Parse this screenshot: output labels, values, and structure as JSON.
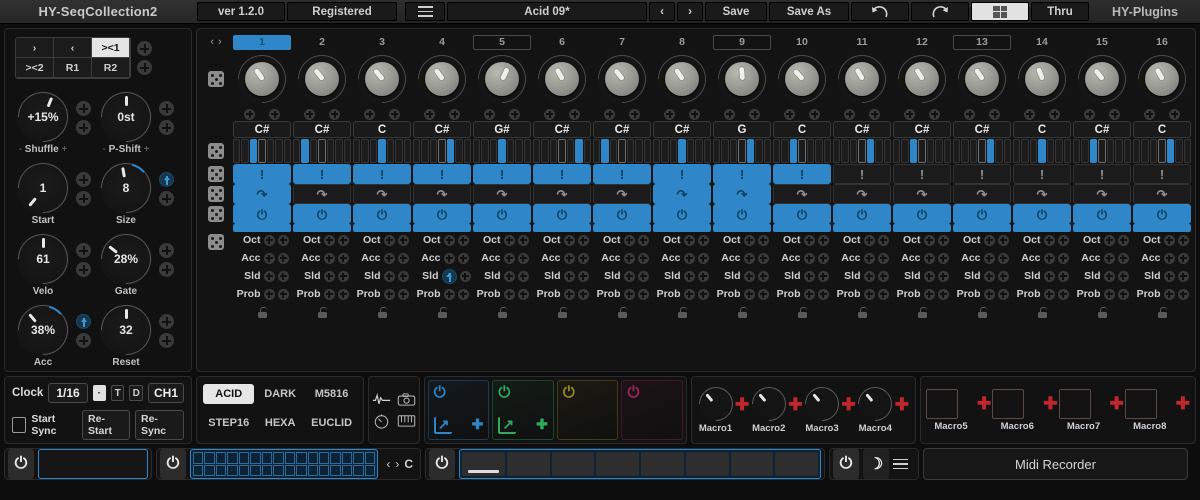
{
  "topbar": {
    "title": "HY-SeqCollection2",
    "version": "ver 1.2.0",
    "license": "Registered",
    "menu_icon": "hamburger-icon",
    "preset_name": "Acid 09*",
    "prev_label": "‹",
    "next_label": "›",
    "save_label": "Save",
    "save_as_label": "Save As",
    "undo_icon": "undo-icon",
    "redo_icon": "redo-icon",
    "grid_icon": "grid-view-icon",
    "thru_label": "Thru",
    "brand": "HY-Plugins"
  },
  "left_panel": {
    "transport_buttons": [
      {
        "label": "›",
        "active": false
      },
      {
        "label": "‹",
        "active": false
      },
      {
        "label": "><1",
        "active": true
      },
      {
        "label": "><2",
        "active": false
      },
      {
        "label": "R1",
        "active": false
      },
      {
        "label": "R2",
        "active": false
      }
    ],
    "knobs": [
      {
        "value": "+15%",
        "label": "Shuffle",
        "angle": 22,
        "arc": false,
        "mod": false,
        "bipolar": true
      },
      {
        "value": "0st",
        "label": "P-Shift",
        "angle": 0,
        "arc": false,
        "mod": false,
        "bipolar": true
      },
      {
        "value": "1",
        "label": "Start",
        "angle": -140,
        "arc": false,
        "mod": false,
        "bipolar": false
      },
      {
        "value": "8",
        "label": "Size",
        "angle": -10,
        "arc": true,
        "mod": true,
        "bipolar": false
      },
      {
        "value": "61",
        "label": "Velo",
        "angle": 0,
        "arc": false,
        "mod": false,
        "bipolar": false
      },
      {
        "value": "28%",
        "label": "Gate",
        "angle": -52,
        "arc": false,
        "mod": false,
        "bipolar": false
      },
      {
        "value": "38%",
        "label": "Acc",
        "angle": -40,
        "arc": true,
        "mod": true,
        "bipolar": false
      },
      {
        "value": "32",
        "label": "Reset",
        "angle": 0,
        "arc": false,
        "mod": false,
        "bipolar": false
      }
    ]
  },
  "sequencer": {
    "page_prev": "‹",
    "page_next": "›",
    "dice_icon": "dice-randomize-icon",
    "steps": [
      1,
      2,
      3,
      4,
      5,
      6,
      7,
      8,
      9,
      10,
      11,
      12,
      13,
      14,
      15,
      16
    ],
    "current_step": 1,
    "marked_steps": [
      5,
      9,
      13
    ],
    "pitch_angles": [
      -35,
      -38,
      -40,
      -36,
      25,
      -30,
      -38,
      -34,
      -5,
      -42,
      -30,
      -32,
      -34,
      -22,
      -38,
      -30
    ],
    "notes": [
      "C#",
      "C#",
      "C",
      "C#",
      "G#",
      "C#",
      "C#",
      "C#",
      "G",
      "C",
      "C#",
      "C#",
      "C#",
      "C",
      "C#",
      "C"
    ],
    "velocity_cells": [
      [
        0,
        0,
        1,
        0,
        0,
        0,
        0
      ],
      [
        0,
        1,
        0,
        0,
        0,
        0,
        0
      ],
      [
        0,
        0,
        0,
        1,
        0,
        0,
        0
      ],
      [
        0,
        0,
        0,
        0,
        1,
        0,
        0
      ],
      [
        0,
        0,
        0,
        1,
        0,
        0,
        0
      ],
      [
        0,
        0,
        0,
        0,
        0,
        1,
        0
      ],
      [
        0,
        1,
        0,
        0,
        0,
        0,
        0
      ],
      [
        0,
        0,
        0,
        1,
        0,
        0,
        0
      ],
      [
        0,
        0,
        0,
        0,
        1,
        0,
        0
      ],
      [
        0,
        0,
        1,
        0,
        0,
        0,
        0
      ],
      [
        0,
        0,
        0,
        0,
        1,
        0,
        0
      ],
      [
        0,
        0,
        1,
        0,
        0,
        0,
        0
      ],
      [
        0,
        0,
        0,
        0,
        1,
        0,
        0
      ],
      [
        0,
        0,
        0,
        1,
        0,
        0,
        0
      ],
      [
        0,
        0,
        1,
        0,
        0,
        0,
        0
      ],
      [
        0,
        0,
        0,
        0,
        1,
        0,
        0
      ]
    ],
    "rows": [
      {
        "name": "accent",
        "glyph": "!",
        "states": [
          1,
          1,
          1,
          1,
          1,
          1,
          1,
          1,
          1,
          1,
          0,
          0,
          0,
          0,
          0,
          0
        ]
      },
      {
        "name": "slide",
        "glyph": "↷",
        "states": [
          1,
          0,
          0,
          0,
          0,
          0,
          0,
          1,
          1,
          0,
          0,
          0,
          0,
          0,
          0,
          0
        ]
      },
      {
        "name": "gate",
        "glyph": "⏻",
        "states": [
          1,
          1,
          1,
          1,
          1,
          1,
          1,
          1,
          1,
          1,
          1,
          1,
          1,
          1,
          1,
          1
        ]
      },
      {
        "name": "bar",
        "glyph": "",
        "states": [
          1,
          1,
          1,
          1,
          1,
          1,
          1,
          1,
          1,
          1,
          1,
          1,
          1,
          1,
          1,
          1
        ]
      }
    ],
    "param_rows": [
      "Oct",
      "Acc",
      "Sld",
      "Prob"
    ],
    "lock_icon": "lock-icon",
    "sld_mod_step": 4
  },
  "clock_panel": {
    "clock_label": "Clock",
    "rate": "1/16",
    "dot_label": "·",
    "t_label": "T",
    "d_label": "D",
    "channel": "CH1",
    "start_sync_label": "Start Sync",
    "restart_label": "Re-Start",
    "resync_label": "Re-Sync"
  },
  "mode_panel": {
    "buttons": [
      {
        "label": "ACID",
        "active": true
      },
      {
        "label": "DARK",
        "active": false
      },
      {
        "label": "M5816",
        "active": false
      },
      {
        "label": "STEP16",
        "active": false
      },
      {
        "label": "HEXA",
        "active": false
      },
      {
        "label": "EUCLID",
        "active": false
      }
    ]
  },
  "tool_panel": {
    "icons": [
      "waveform-icon",
      "camera-icon",
      "metronome-icon",
      "keyboard-icon"
    ]
  },
  "slots": [
    {
      "color": "#2f87c9",
      "power_icon": "power-icon",
      "open_icon": "open-external-icon",
      "add_icon": "add-icon",
      "has_actions": true
    },
    {
      "color": "#2eac5e",
      "power_icon": "power-icon",
      "open_icon": "open-external-icon",
      "add_icon": "add-icon",
      "has_actions": true
    },
    {
      "color": "#9a8a16",
      "power_icon": "power-icon",
      "open_icon": "",
      "add_icon": "",
      "has_actions": false
    },
    {
      "color": "#a8245c",
      "power_icon": "power-icon",
      "open_icon": "",
      "add_icon": "",
      "has_actions": false
    }
  ],
  "macros_knobs": [
    {
      "label": "Macro1",
      "angle": -40
    },
    {
      "label": "Macro2",
      "angle": -40
    },
    {
      "label": "Macro3",
      "angle": -40
    },
    {
      "label": "Macro4",
      "angle": -40
    }
  ],
  "macros_buttons": [
    {
      "label": "Macro5"
    },
    {
      "label": "Macro6"
    },
    {
      "label": "Macro7"
    },
    {
      "label": "Macro8"
    }
  ],
  "bottom_strip": {
    "power_icon": "power-icon",
    "nav_prev": "‹",
    "nav_next": "›",
    "key_label": "C",
    "menu_icon": "hamburger-icon",
    "moon_icon": "moon-icon",
    "recorder_label": "Midi Recorder"
  },
  "colors": {
    "accent_blue": "#2f87c9",
    "accent_red": "#c0272d",
    "accent_green": "#2eac5e",
    "panel_bg": "#131313"
  }
}
